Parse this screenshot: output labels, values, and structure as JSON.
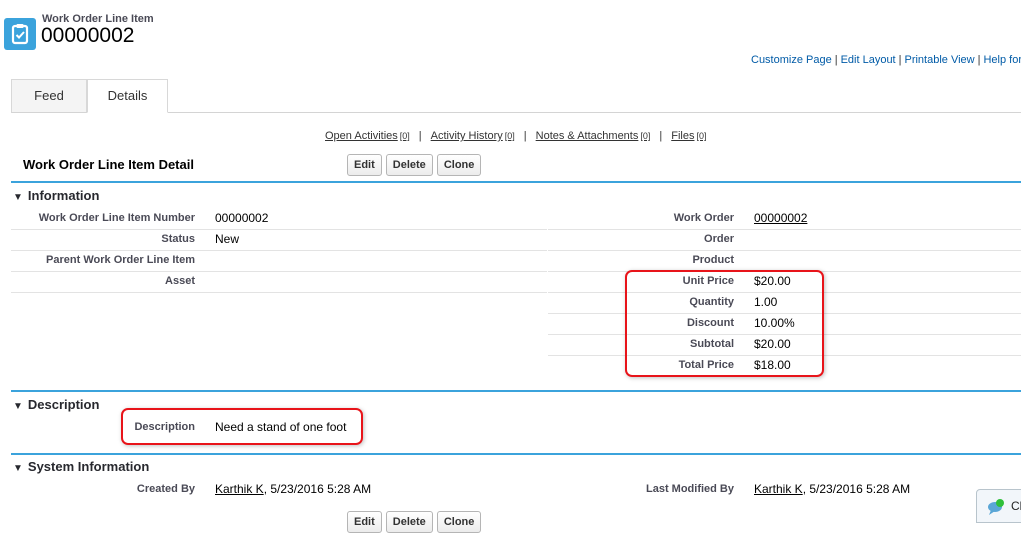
{
  "header": {
    "object_type": "Work Order Line Item",
    "record_name": "00000002",
    "icon": "clipboard-check-icon"
  },
  "top_links": [
    "Customize Page",
    "Edit Layout",
    "Printable View",
    "Help for t"
  ],
  "tabs": [
    {
      "label": "Feed",
      "active": false
    },
    {
      "label": "Details",
      "active": true
    }
  ],
  "related_links": [
    {
      "label": "Open Activities",
      "count": "[0]"
    },
    {
      "label": "Activity History",
      "count": "[0]"
    },
    {
      "label": "Notes & Attachments",
      "count": "[0]"
    },
    {
      "label": "Files",
      "count": "[0]"
    }
  ],
  "related_sep": "|",
  "detail": {
    "title": "Work Order Line Item Detail",
    "buttons": {
      "edit": "Edit",
      "delete": "Delete",
      "clone": "Clone"
    }
  },
  "sections": {
    "information": {
      "title": "Information",
      "left": [
        {
          "label": "Work Order Line Item Number",
          "value": "00000002"
        },
        {
          "label": "Status",
          "value": "New"
        },
        {
          "label": "Parent Work Order Line Item",
          "value": ""
        },
        {
          "label": "Asset",
          "value": ""
        }
      ],
      "right": [
        {
          "label": "Work Order",
          "value": "00000002",
          "link": true
        },
        {
          "label": "Order",
          "value": ""
        },
        {
          "label": "Product",
          "value": ""
        },
        {
          "label": "Unit Price",
          "value": "$20.00"
        },
        {
          "label": "Quantity",
          "value": "1.00"
        },
        {
          "label": "Discount",
          "value": "10.00%"
        },
        {
          "label": "Subtotal",
          "value": "$20.00"
        },
        {
          "label": "Total Price",
          "value": "$18.00"
        }
      ]
    },
    "description": {
      "title": "Description",
      "label": "Description",
      "value": "Need a stand of one foot"
    },
    "system": {
      "title": "System Information",
      "created_label": "Created By",
      "created_user": "Karthik K",
      "created_date": ", 5/23/2016 5:28 AM",
      "modified_label": "Last Modified By",
      "modified_user": "Karthik K",
      "modified_date": ", 5/23/2016 5:28 AM"
    }
  },
  "chat": {
    "label": "Cl"
  },
  "colors": {
    "accent": "#3ba3dc",
    "highlight": "#e8141a",
    "link": "#015ba7"
  }
}
